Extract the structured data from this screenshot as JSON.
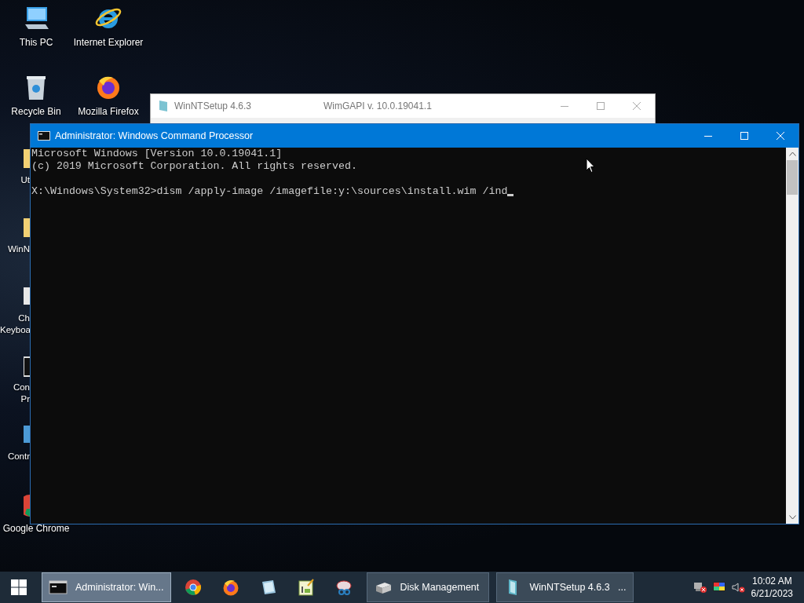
{
  "desktop_icons": [
    {
      "kind": "pc",
      "label_lines": [
        "This PC"
      ]
    },
    {
      "kind": "recycle",
      "label_lines": [
        "Recycle Bin"
      ]
    },
    {
      "kind": "folder-edge",
      "label_lines": [
        "Ut"
      ]
    },
    {
      "kind": "folder-edge",
      "label_lines": [
        "WinN"
      ]
    },
    {
      "kind": "doc-edge",
      "label_lines": [
        "Ch",
        "Keyboa"
      ]
    },
    {
      "kind": "cmd-edge",
      "label_lines": [
        "Con",
        "Pr"
      ]
    },
    {
      "kind": "control-edge",
      "label_lines": [
        "Contr"
      ]
    },
    {
      "kind": "chrome-edge",
      "label_lines": [
        "Google Chrome"
      ]
    },
    {
      "kind": "ie",
      "label_lines": [
        "Internet Explorer"
      ]
    },
    {
      "kind": "firefox",
      "label_lines": [
        "Mozilla Firefox"
      ]
    }
  ],
  "winntsetup_window": {
    "title": "WinNTSetup 4.6.3",
    "subtitle": "WimGAPI v. 10.0.19041.1"
  },
  "cmd_window": {
    "title": "Administrator: Windows Command Processor",
    "banner": [
      "Microsoft Windows [Version 10.0.19041.1]",
      "(c) 2019 Microsoft Corporation. All rights reserved."
    ],
    "command_line": "X:\\Windows\\System32>dism /apply-image /imagefile:y:\\sources\\install.wim /ind"
  },
  "taskbar": {
    "items": [
      {
        "kind": "window",
        "label": "Administrator: Win...",
        "selected": true
      },
      {
        "kind": "pinned"
      },
      {
        "kind": "pinned"
      },
      {
        "kind": "pinned"
      },
      {
        "kind": "pinned"
      },
      {
        "kind": "pinned"
      },
      {
        "kind": "window",
        "label": "Disk Management",
        "selected": false
      },
      {
        "kind": "window",
        "label": "WinNTSetup 4.6.3   ...",
        "selected": false
      }
    ],
    "time": "10:02 AM",
    "date": "6/21/2023"
  }
}
